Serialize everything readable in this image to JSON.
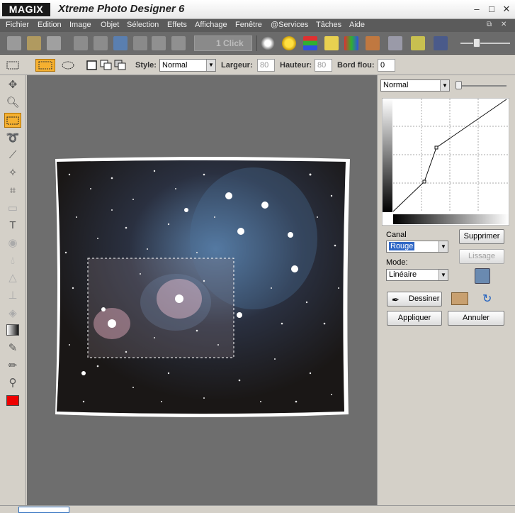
{
  "app": {
    "logo": "MAGIX",
    "title": "Xtreme Photo Designer 6"
  },
  "menu": {
    "items": [
      "Fichier",
      "Edition",
      "Image",
      "Objet",
      "Sélection",
      "Effets",
      "Affichage",
      "Fenêtre",
      "@Services",
      "Tâches",
      "Aide"
    ]
  },
  "toolbar": {
    "one_click": "1 Click"
  },
  "selection_options": {
    "style_label": "Style:",
    "style_value": "Normal",
    "width_label": "Largeur:",
    "width_value": "80",
    "height_label": "Hauteur:",
    "height_value": "80",
    "feather_label": "Bord flou:",
    "feather_value": "0"
  },
  "curves_panel": {
    "blend_mode": "Normal",
    "channel_label": "Canal",
    "channel_value": "Rouge",
    "mode_label": "Mode:",
    "mode_value": "Linéaire",
    "delete_button": "Supprimer",
    "smooth_button": "Lissage",
    "draw_button": "Dessiner",
    "apply_button": "Appliquer",
    "cancel_button": "Annuler"
  },
  "colors": {
    "foreground": "#ee0000",
    "active_tool": "#f5b030",
    "menubar": "#5b5b5b",
    "canvas_bg": "#6e6e6e"
  }
}
